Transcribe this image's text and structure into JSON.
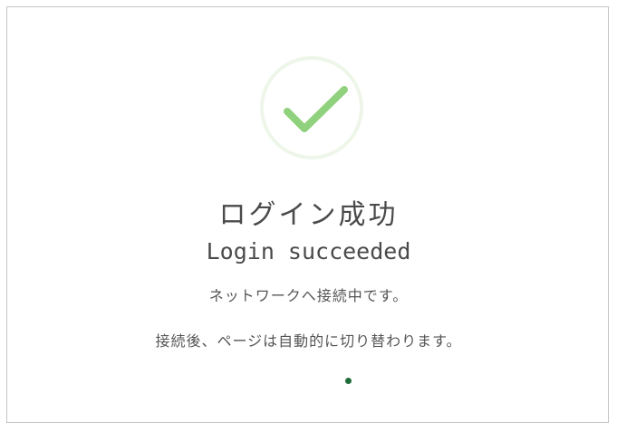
{
  "status": {
    "icon": "checkmark-icon",
    "title_ja": "ログイン成功",
    "title_en": "Login succeeded"
  },
  "messages": {
    "connecting": "ネットワークへ接続中です。",
    "redirect": "接続後、ページは自動的に切り替わります。"
  },
  "colors": {
    "check": "#8fd17c",
    "circle": "#eef6ea",
    "loading_dot": "#1f6e3a",
    "text": "#4a4a4a"
  }
}
